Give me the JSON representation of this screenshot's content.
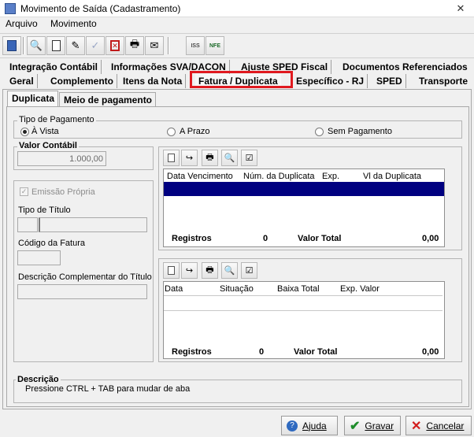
{
  "window": {
    "title": "Movimento de Saída (Cadastramento)",
    "close_glyph": "✕"
  },
  "menu": [
    "Arquivo",
    "Movimento"
  ],
  "toolbar_icons": [
    "exit-icon",
    "search-icon",
    "new-document-icon",
    "edit-icon",
    "confirm-icon",
    "delete-icon",
    "print-icon",
    "email-icon",
    "iss-icon",
    "nfe-icon"
  ],
  "toolbar_badges": {
    "iss": "ISS",
    "nfe": "NFE"
  },
  "tabs_row1": [
    "Integração Contábil",
    "Informações SVA/DACON",
    "Ajuste SPED Fiscal",
    "Documentos Referenciados"
  ],
  "tabs_row2": [
    "Geral",
    "Complemento",
    "Itens da Nota",
    "Fatura / Duplicata",
    "Específico - RJ",
    "SPED",
    "Transporte"
  ],
  "active_tab": "Fatura / Duplicata",
  "subtabs": [
    "Duplicata",
    "Meio de pagamento"
  ],
  "tipo_pagamento": {
    "title": "Tipo de Pagamento",
    "options": [
      "À Vista",
      "A Prazo",
      "Sem Pagamento"
    ],
    "selected": "À Vista"
  },
  "valor_contabil": {
    "label": "Valor Contábil",
    "value": "1.000,00"
  },
  "emissao_propria": {
    "label": "Emissão Própria",
    "checked": true
  },
  "tipo_titulo": {
    "label": "Tipo de Título"
  },
  "codigo_fatura": {
    "label": "Código da Fatura"
  },
  "descricao_titulo": {
    "label": "Descrição Complementar do Título"
  },
  "duplicatas_grid": {
    "columns": [
      "Data Vencimento",
      "Núm. da Duplicata",
      "Exp.",
      "Vl da Duplicata"
    ],
    "registros_label": "Registros",
    "registros_value": "0",
    "total_label": "Valor Total",
    "total_value": "0,00"
  },
  "baixas_grid": {
    "columns": [
      "Data",
      "Situação",
      "Baixa Total",
      "Exp. Valor"
    ],
    "registros_label": "Registros",
    "registros_value": "0",
    "total_label": "Valor Total",
    "total_value": "0,00"
  },
  "descricao": {
    "title": "Descrição",
    "text": "Pressione CTRL + TAB para  mudar de aba"
  },
  "buttons": {
    "ajuda": "Ajuda",
    "gravar": "Gravar",
    "cancelar": "Cancelar"
  },
  "colors": {
    "highlight_border": "#e0191f",
    "selected_row": "#000080"
  }
}
